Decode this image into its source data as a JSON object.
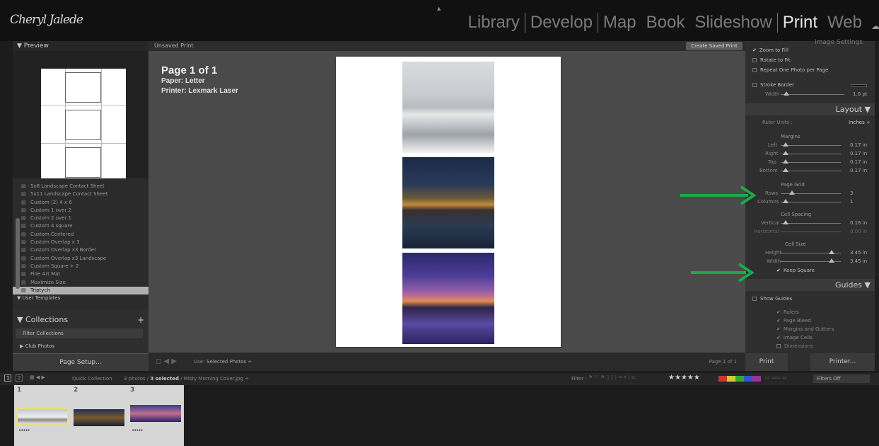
{
  "app": {
    "logo_text": "Cheryl Jalede",
    "modules": [
      "Library",
      "Develop",
      "Map",
      "Book",
      "Slideshow",
      "Print",
      "Web"
    ],
    "active_module": "Print"
  },
  "left_panel": {
    "preview_header": "▼ Preview",
    "templates": [
      "5x8 Landscape Contact Sheet",
      "5x11 Landscape Contact Sheet",
      "Custom (2) 4 x 6",
      "Custom 1 over 2",
      "Custom 2 over 1",
      "Custom 4 square",
      "Custom Centered",
      "Custom Overlap x 3",
      "Custom Overlap x3 Border",
      "Custom Overlap x3 Landscape",
      "Custom Square + 2",
      "Fine Art Mat",
      "Maximize Size",
      "Triptych"
    ],
    "selected_template": "Triptych",
    "user_templates": "▼ User Templates",
    "collections_header": "▼ Collections",
    "filter_collections": "Filter Collections",
    "club_photos": "▶ Club Photos",
    "page_setup": "Page Setup..."
  },
  "center": {
    "unsaved_label": "Unsaved Print",
    "create_saved_print": "Create Saved Print",
    "page_title": "Page 1 of 1",
    "paper": "Paper:  Letter",
    "printer": "Printer:  Lexmark Laser",
    "use_label": "Use:",
    "use_value": "Selected Photos ÷",
    "page_counter": "Page 1 of 1"
  },
  "right_panel": {
    "image_settings": "Image Settings",
    "zoom_to_fill": "Zoom to Fill",
    "rotate_to_fit": "Rotate to Fit",
    "repeat_one_photo": "Repeat One Photo per Page",
    "stroke_border": "Stroke Border",
    "width_label": "Width",
    "stroke_width": "1.0 pt",
    "layout_header": "Layout ▼",
    "ruler_units_label": "Ruler Units :",
    "ruler_units_value": "Inches ÷",
    "margins_label": "Margins",
    "left_label": "Left",
    "left_value": "0.17 in",
    "right_label": "Right",
    "right_value": "0.17 in",
    "top_label": "Top",
    "top_value": "0.17 in",
    "bottom_label": "Bottom",
    "bottom_value": "0.17 in",
    "page_grid_label": "Page Grid",
    "rows_label": "Rows",
    "rows_value": "3",
    "columns_label": "Columns",
    "columns_value": "1",
    "cell_spacing_label": "Cell Spacing",
    "vertical_label": "Vertical",
    "vertical_value": "0.16 in",
    "horizontal_label": "Horizontal",
    "horizontal_value": "0.00 in",
    "cell_size_label": "Cell Size",
    "height_label": "Height",
    "height_value": "3.45 in",
    "width_cell_label": "Width",
    "width_cell_value": "3.45 in",
    "keep_square": "Keep Square",
    "guides_header": "Guides ▼",
    "show_guides": "Show Guides",
    "rulers": "Rulers",
    "page_bleed": "Page Bleed",
    "margins_gutters": "Margins and Gutters",
    "image_cells": "Image Cells",
    "dimensions": "Dimensions",
    "print_button": "Print",
    "printer_button": "Printer..."
  },
  "filmstrip": {
    "view1": "1",
    "view2": "2",
    "source": "Quick Collection",
    "summary_prefix": "3 photos /",
    "summary_selected": "3 selected",
    "summary_file": "/ Misty Morning Cover.jpg ÷",
    "filter_label": "Filter :",
    "filter_value": "Filters Off",
    "cell_numbers": [
      "1",
      "2",
      "3"
    ],
    "colors": {
      "accent_arrow": "#1fa84a",
      "selection": "#d0d0d0"
    }
  }
}
